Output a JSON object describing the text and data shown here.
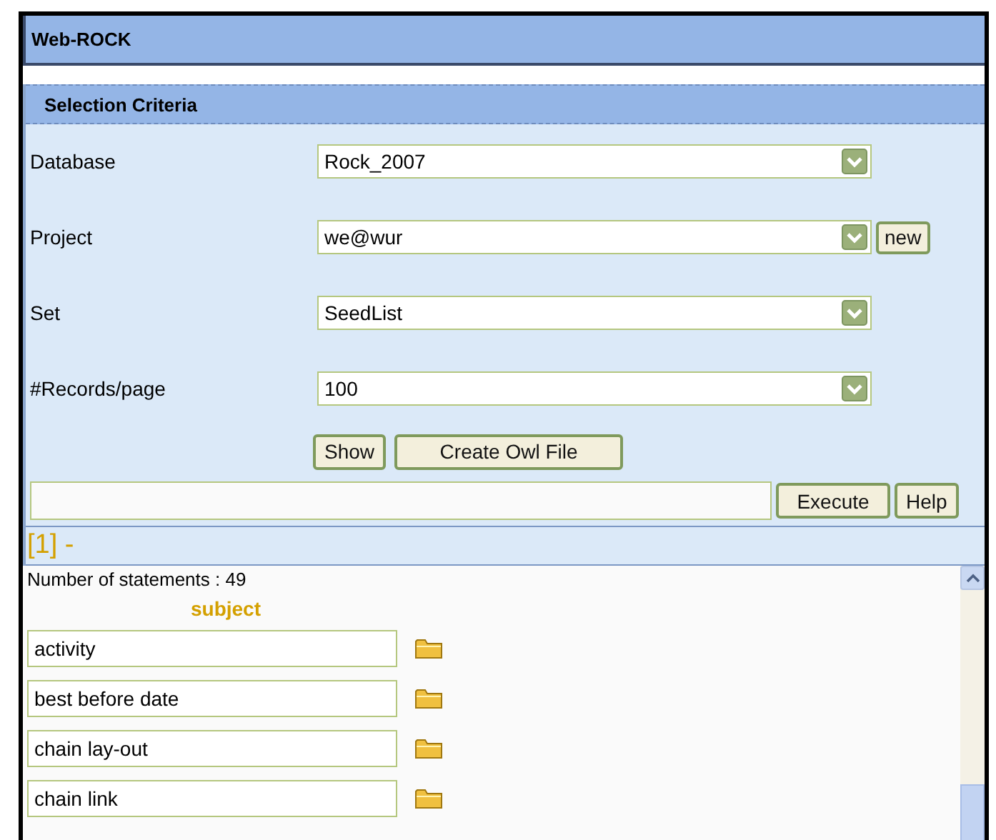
{
  "app_title": "Web-ROCK",
  "section_title": "Selection Criteria",
  "criteria": [
    {
      "label": "Database",
      "value": "Rock_2007"
    },
    {
      "label": "Project",
      "value": "we@wur",
      "extra_button": "new"
    },
    {
      "label": "Set",
      "value": "SeedList"
    },
    {
      "label": "#Records/page",
      "value": "100"
    }
  ],
  "actions": [
    "Show",
    "Create Owl File"
  ],
  "query": {
    "buttons": [
      "Execute",
      "Help"
    ]
  },
  "result": {
    "heading": "[1] -",
    "count_text": "Number of statements : 49",
    "column": "subject",
    "items": [
      "activity",
      "best before date",
      "chain lay-out",
      "chain link"
    ]
  }
}
